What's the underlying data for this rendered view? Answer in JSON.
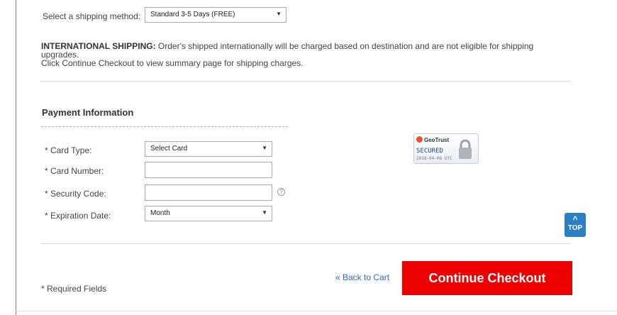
{
  "shipping": {
    "label": "Select a shipping method:",
    "selected": "Standard 3-5 Days (FREE)",
    "intl_heading": "INTERNATIONAL SHIPPING:",
    "intl_text": " Order's shipped internationally will be charged based on destination and are not eligible for shipping upgrades.",
    "intl_text2": "Click Continue Checkout to view summary page for shipping charges."
  },
  "payment": {
    "title": "Payment Information",
    "card_type_label": "* Card Type:",
    "card_type_value": "Select Card",
    "card_number_label": "* Card Number:",
    "security_code_label": "* Security Code:",
    "help_glyph": "?",
    "expiration_label": "* Expiration Date:",
    "month_value": "Month"
  },
  "badge": {
    "brand": "GeoTrust",
    "secured": "SECURED",
    "date": "2018-04-06 UTC"
  },
  "top_button": {
    "label": "TOP"
  },
  "footer": {
    "back_link": "« Back to Cart",
    "continue": "Continue Checkout",
    "required": "* Required Fields"
  },
  "icons": {
    "dropdown": "chevron-down-icon",
    "help": "question-circle-icon",
    "top": "chevron-up-icon",
    "lock": "padlock-icon"
  },
  "colors": {
    "checkout_button": "#ee0000",
    "top_button": "#2c7fc2",
    "link": "#2a6ebb"
  }
}
